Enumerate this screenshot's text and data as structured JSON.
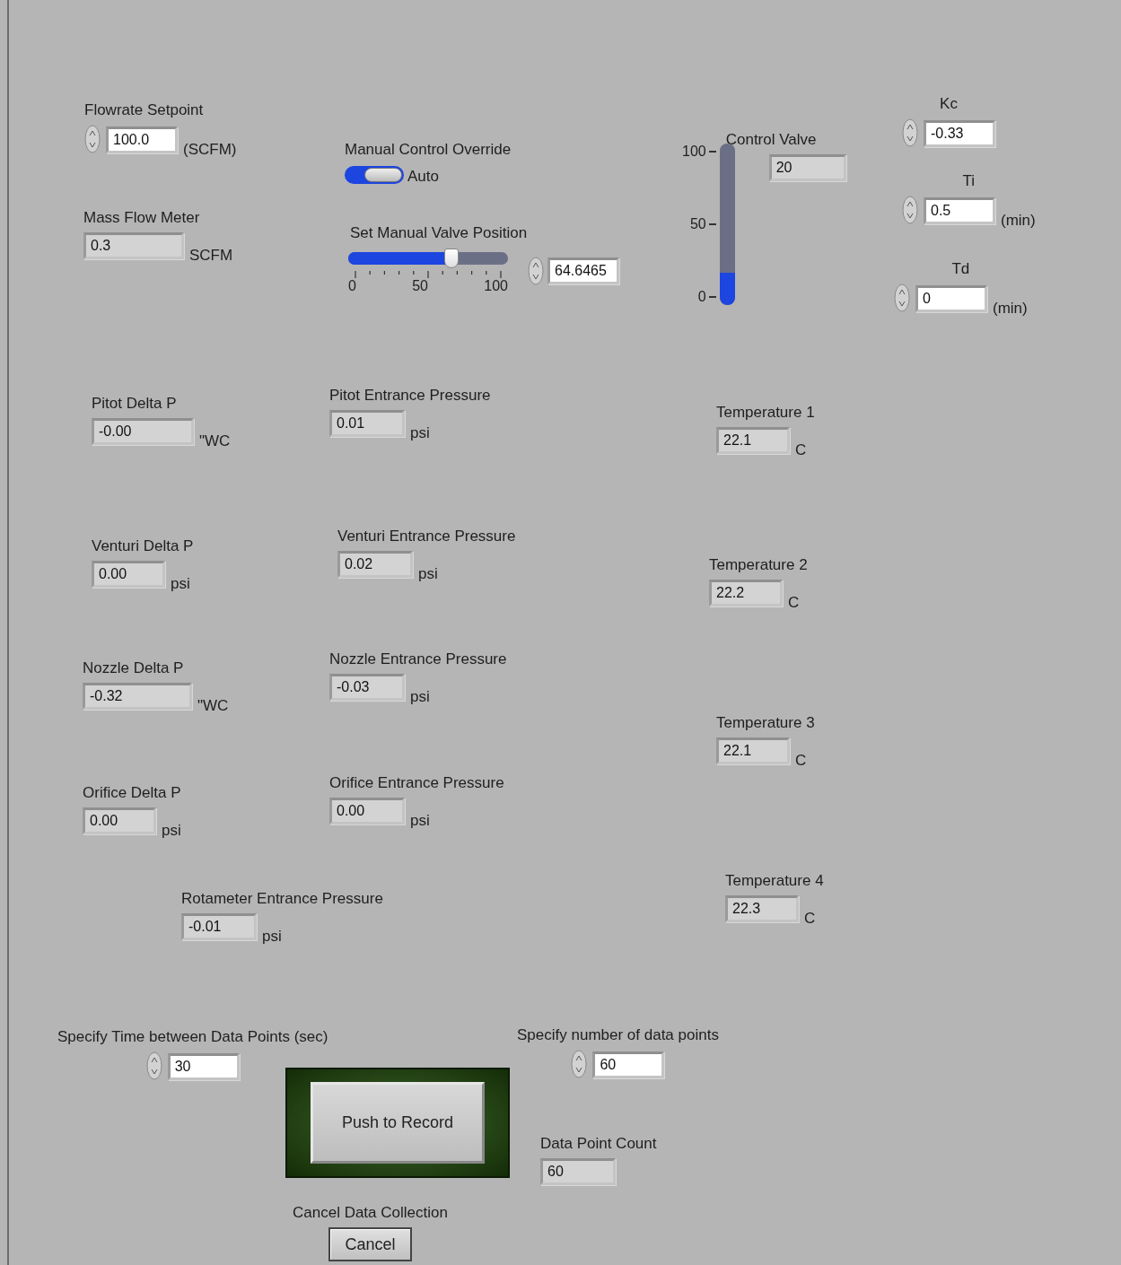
{
  "panel": {
    "controls": [
      {
        "kind": "control",
        "label": "Flowrate Setpoint",
        "value": "100.0",
        "unit": "(SCFM)"
      },
      {
        "kind": "indicator",
        "label": "Mass Flow Meter",
        "value": "0.3",
        "unit": "SCFM"
      },
      {
        "kind": "toggle",
        "label": "Manual Control Override",
        "text": "Auto",
        "on": false
      },
      {
        "kind": "slider",
        "label": "Set Manual Valve Position",
        "level": 0.646,
        "ticks": [
          "0",
          "50",
          "100"
        ],
        "value": "64.6465"
      },
      {
        "kind": "tank",
        "label": "Control Valve",
        "level": 0.2,
        "ticks": [
          "100",
          "50",
          "0"
        ],
        "value": "20"
      },
      {
        "kind": "control",
        "label": "Kc",
        "value": "-0.33"
      },
      {
        "kind": "control",
        "label": "Ti",
        "value": "0.5",
        "unit": "(min)"
      },
      {
        "kind": "control",
        "label": "Td",
        "value": "0",
        "unit": "(min)"
      },
      {
        "kind": "indicator",
        "label": "Pitot Delta P",
        "value": "-0.00",
        "unit": "\"WC"
      },
      {
        "kind": "indicator",
        "label": "Pitot Entrance Pressure",
        "value": "0.01",
        "unit": "psi"
      },
      {
        "kind": "indicator",
        "label": "Temperature 1",
        "value": "22.1",
        "unit": "C"
      },
      {
        "kind": "indicator",
        "label": "Venturi Delta P",
        "value": "0.00",
        "unit": "psi"
      },
      {
        "kind": "indicator",
        "label": "Venturi Entrance Pressure",
        "value": "0.02",
        "unit": "psi"
      },
      {
        "kind": "indicator",
        "label": "Temperature 2",
        "value": "22.2",
        "unit": "C"
      },
      {
        "kind": "indicator",
        "label": "Nozzle Delta P",
        "value": "-0.32",
        "unit": "\"WC"
      },
      {
        "kind": "indicator",
        "label": "Nozzle Entrance Pressure",
        "value": "-0.03",
        "unit": "psi"
      },
      {
        "kind": "indicator",
        "label": "Temperature 3",
        "value": "22.1",
        "unit": "C"
      },
      {
        "kind": "indicator",
        "label": "Orifice Delta P",
        "value": "0.00",
        "unit": "psi"
      },
      {
        "kind": "indicator",
        "label": "Orifice Entrance Pressure",
        "value": "0.00",
        "unit": "psi"
      },
      {
        "kind": "indicator",
        "label": "Temperature 4",
        "value": "22.3",
        "unit": "C"
      },
      {
        "kind": "indicator",
        "label": "Rotameter Entrance Pressure",
        "value": "-0.01",
        "unit": "psi"
      },
      {
        "kind": "control",
        "label": "Specify Time between Data Points (sec)",
        "value": "30"
      },
      {
        "kind": "control",
        "label": "Specify number of data points",
        "value": "60"
      },
      {
        "kind": "bigbutton",
        "text": "Push to Record"
      },
      {
        "kind": "indicator",
        "label": "Data Point Count",
        "value": "60"
      },
      {
        "kind": "button",
        "label": "Cancel Data Collection",
        "text": "Cancel"
      }
    ]
  }
}
